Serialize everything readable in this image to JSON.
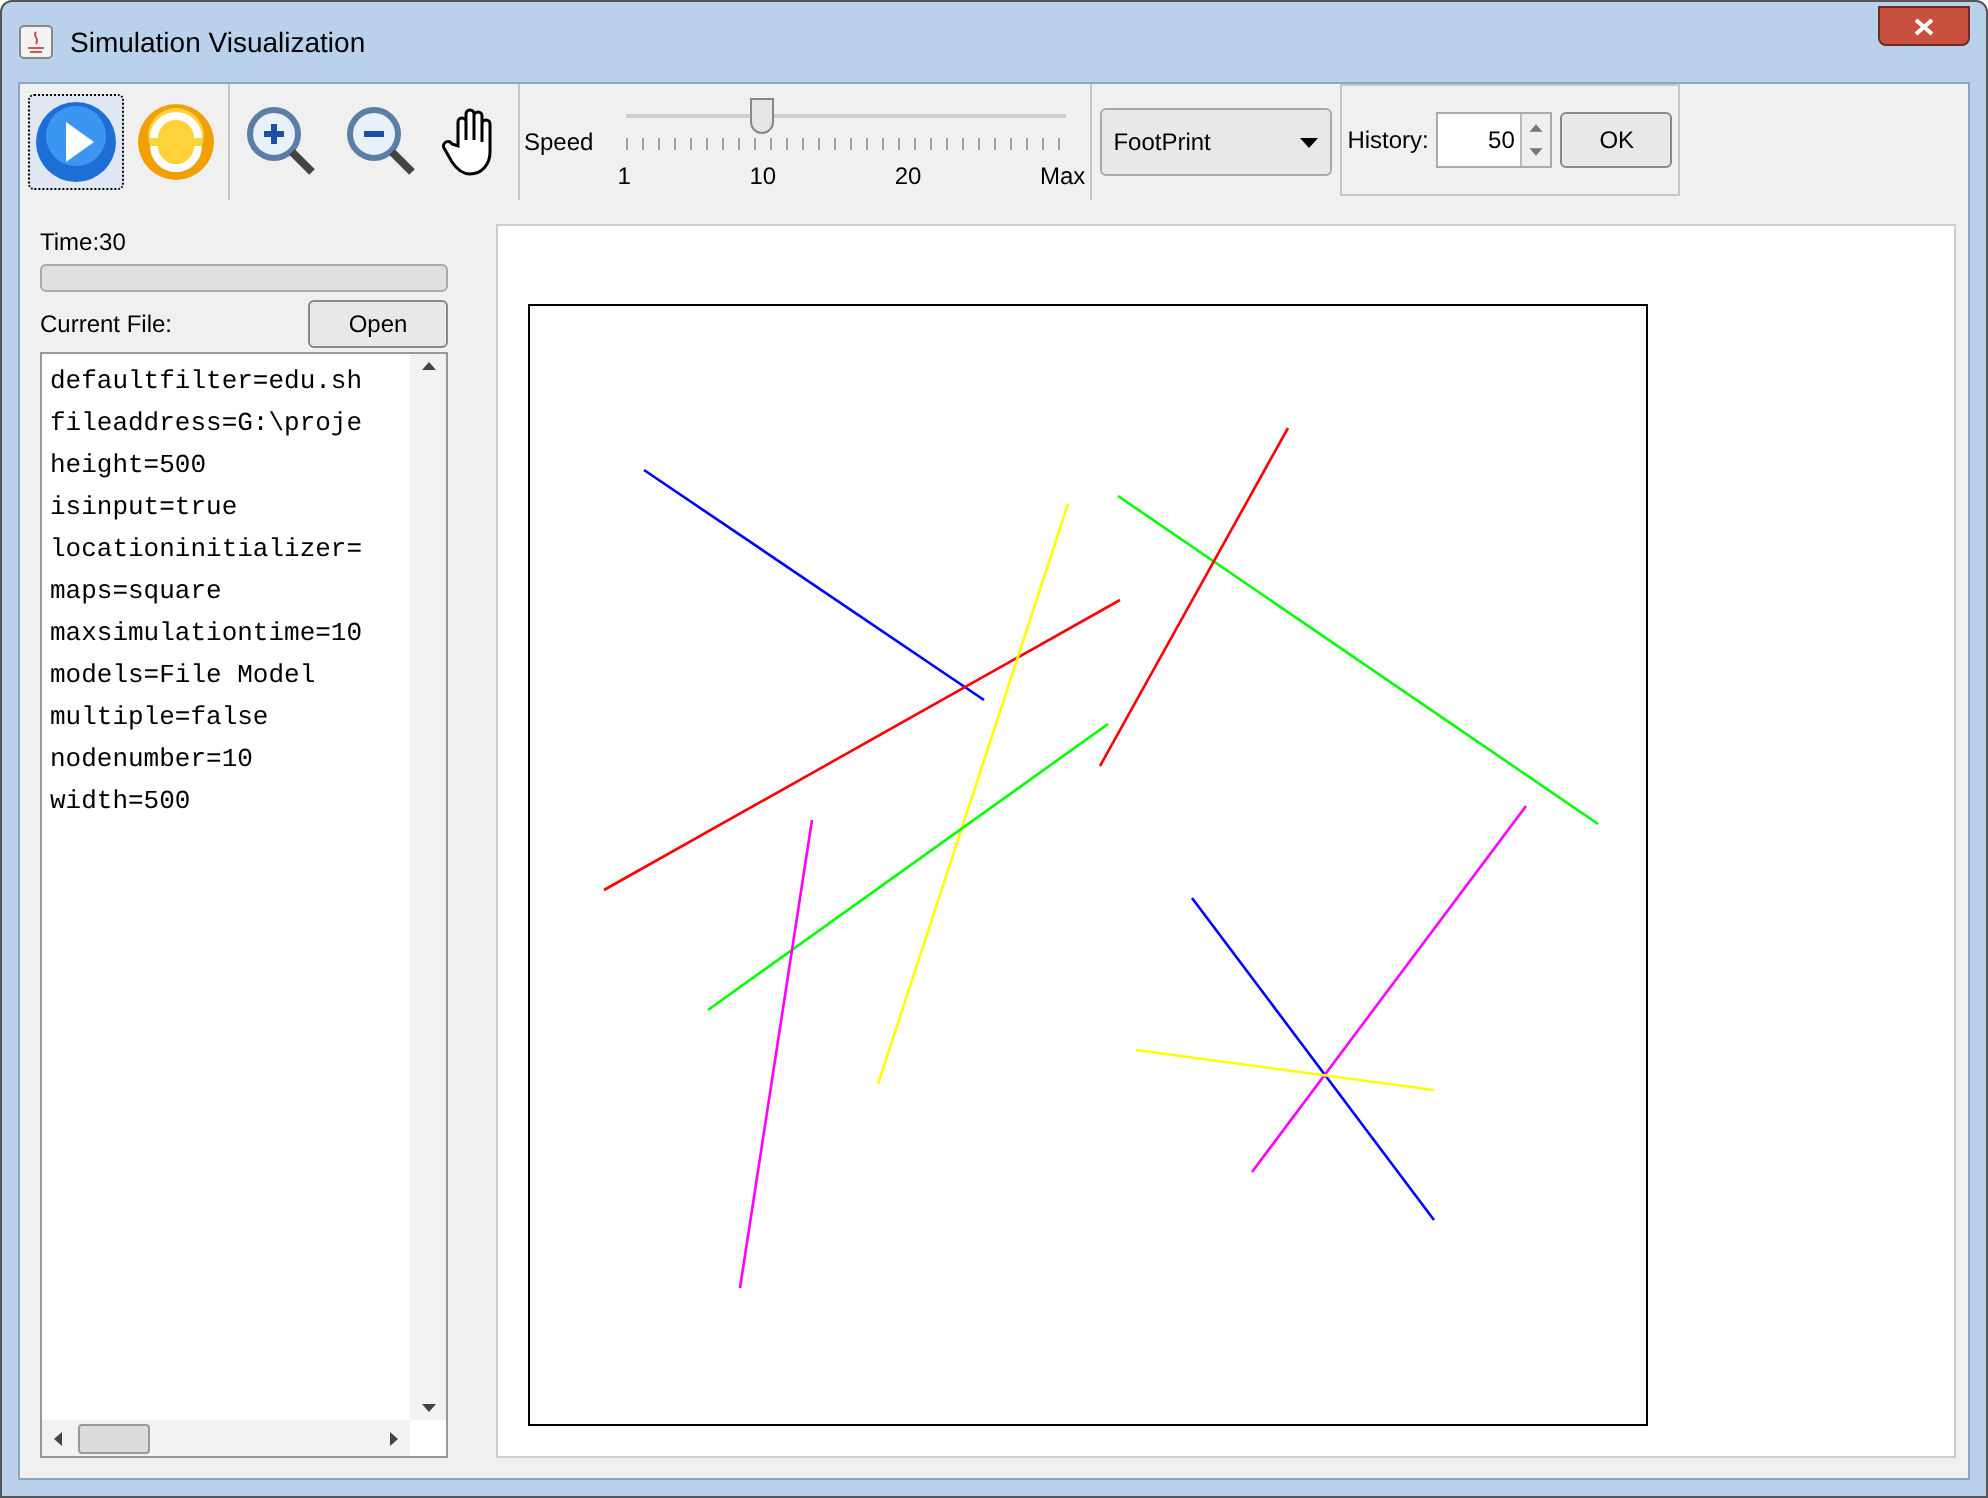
{
  "window": {
    "title": "Simulation Visualization"
  },
  "toolbar": {
    "speed_label": "Speed",
    "speed": {
      "level": 0.31,
      "ticks": [
        "1",
        "10",
        "20",
        "Max"
      ]
    },
    "mode": {
      "value": "FootPrint"
    },
    "history_label": "History:",
    "history_value": "50",
    "ok": "OK"
  },
  "left_panel": {
    "time": "Time:30",
    "progress": {
      "level": 0
    },
    "current_file_label": "Current File:",
    "open": "Open",
    "file_lines": [
      "defaultfilter=edu.sh",
      "fileaddress=G:\\proje",
      "height=500",
      "isinput=true",
      "locationinitializer=",
      "maps=square",
      "maxsimulationtime=10",
      "models=File Model",
      "multiple=false",
      "nodenumber=10",
      "width=500"
    ]
  },
  "tracks": [
    {
      "color": "#0000ff"
    },
    {
      "color": "#ff0000"
    },
    {
      "color": "#ffff00"
    },
    {
      "color": "#00ff00"
    },
    {
      "color": "#ff0000"
    },
    {
      "color": "#00ff00"
    },
    {
      "color": "#ff00ff"
    },
    {
      "color": "#0000ff"
    },
    {
      "color": "#ff00ff"
    },
    {
      "color": "#ffff00"
    }
  ]
}
